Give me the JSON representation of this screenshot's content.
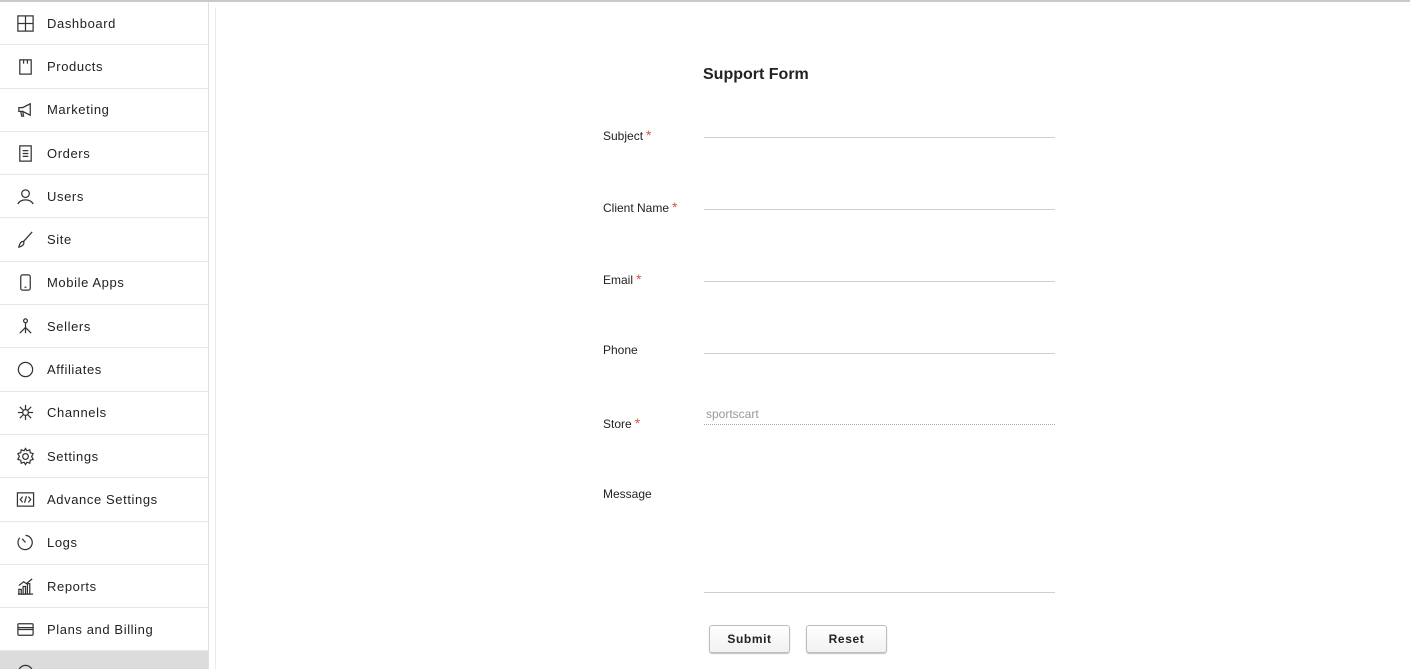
{
  "sidebar": {
    "items": [
      {
        "label": "Dashboard",
        "icon": "dashboard-grid-icon"
      },
      {
        "label": "Products",
        "icon": "product-box-icon"
      },
      {
        "label": "Marketing",
        "icon": "megaphone-icon"
      },
      {
        "label": "Orders",
        "icon": "orders-list-icon"
      },
      {
        "label": "Users",
        "icon": "user-icon"
      },
      {
        "label": "Site",
        "icon": "brush-icon"
      },
      {
        "label": "Mobile Apps",
        "icon": "mobile-phone-icon"
      },
      {
        "label": "Sellers",
        "icon": "sellers-network-icon"
      },
      {
        "label": "Affiliates",
        "icon": "circle-icon"
      },
      {
        "label": "Channels",
        "icon": "channels-hub-icon"
      },
      {
        "label": "Settings",
        "icon": "gear-icon"
      },
      {
        "label": "Advance Settings",
        "icon": "code-icon"
      },
      {
        "label": "Logs",
        "icon": "clock-icon"
      },
      {
        "label": "Reports",
        "icon": "bar-chart-icon"
      },
      {
        "label": "Plans and Billing",
        "icon": "credit-card-icon"
      }
    ]
  },
  "form": {
    "title": "Support Form",
    "required_marker": "*",
    "fields": {
      "subject": {
        "label": "Subject",
        "value": ""
      },
      "client_name": {
        "label": "Client Name",
        "value": ""
      },
      "email": {
        "label": "Email",
        "value": ""
      },
      "phone": {
        "label": "Phone",
        "value": ""
      },
      "store": {
        "label": "Store",
        "value": "sportscart"
      },
      "message": {
        "label": "Message",
        "value": ""
      }
    },
    "submit_label": "Submit",
    "reset_label": "Reset"
  }
}
